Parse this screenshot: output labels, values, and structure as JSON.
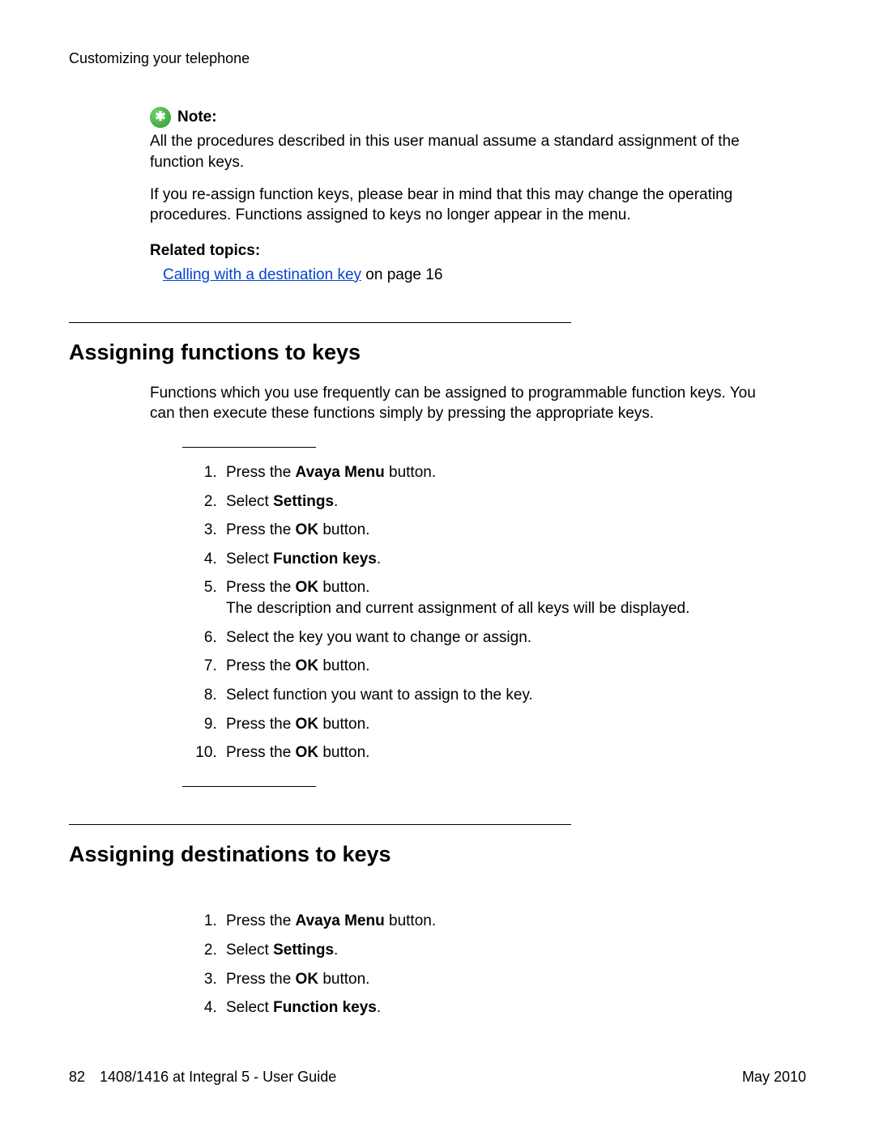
{
  "header": {
    "running": "Customizing your telephone"
  },
  "note": {
    "label": "Note:",
    "p1": "All the procedures described in this user manual assume a standard assignment of the function keys.",
    "p2": "If you re-assign function keys, please bear in mind that this may change the operating procedures. Functions assigned to keys no longer appear in the menu."
  },
  "related": {
    "title": "Related topics:",
    "link_text": "Calling with a destination key",
    "link_suffix": " on page 16"
  },
  "section1": {
    "title": "Assigning functions to keys",
    "intro": "Functions which you use frequently can be assigned to programmable function keys. You can then execute these functions simply by pressing the appropriate keys.",
    "steps": {
      "s1a": "Press the ",
      "s1b": "Avaya Menu",
      "s1c": " button.",
      "s2a": "Select ",
      "s2b": "Settings",
      "s2c": ".",
      "s3a": "Press the ",
      "s3b": "OK",
      "s3c": " button.",
      "s4a": "Select ",
      "s4b": "Function keys",
      "s4c": ".",
      "s5a": "Press the ",
      "s5b": "OK",
      "s5c": " button.",
      "s5extra": "The description and current assignment of all keys will be displayed.",
      "s6": "Select the key you want to change or assign.",
      "s7a": "Press the ",
      "s7b": "OK",
      "s7c": " button.",
      "s8": "Select function you want to assign to the key.",
      "s9a": "Press the ",
      "s9b": "OK",
      "s9c": " button.",
      "s10a": "Press the ",
      "s10b": "OK",
      "s10c": " button."
    }
  },
  "section2": {
    "title": "Assigning destinations to keys",
    "steps": {
      "s1a": "Press the ",
      "s1b": "Avaya Menu",
      "s1c": " button.",
      "s2a": "Select ",
      "s2b": "Settings",
      "s2c": ".",
      "s3a": "Press the ",
      "s3b": "OK",
      "s3c": " button.",
      "s4a": "Select ",
      "s4b": "Function keys",
      "s4c": "."
    }
  },
  "footer": {
    "page_num": "82",
    "doc_title": "1408/1416 at Integral 5 - User Guide",
    "date": "May 2010"
  }
}
